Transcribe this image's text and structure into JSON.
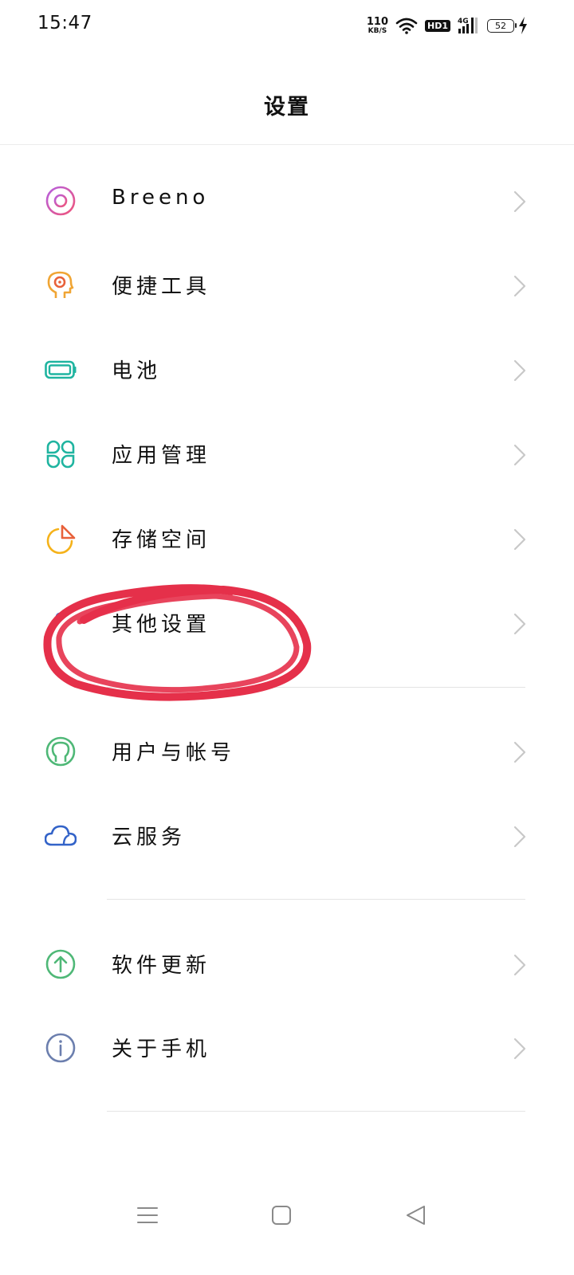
{
  "status_bar": {
    "time": "15:47",
    "net_speed_value": "110",
    "net_speed_unit": "KB/S",
    "hd_label": "HD1",
    "network_label": "4G",
    "battery_level": "52"
  },
  "header": {
    "title": "设置"
  },
  "settings": {
    "items": [
      {
        "label": "Breeno",
        "icon": "breeno-icon",
        "color": "#c85bc4"
      },
      {
        "label": "便捷工具",
        "icon": "convenience-tools-icon",
        "color": "#f0a534"
      },
      {
        "label": "电池",
        "icon": "battery-icon",
        "color": "#1fb4a0"
      },
      {
        "label": "应用管理",
        "icon": "app-management-icon",
        "color": "#1fb4a0"
      },
      {
        "label": "存储空间",
        "icon": "storage-icon",
        "color": "#f5b21a"
      },
      {
        "label": "其他设置",
        "icon": "other-settings-icon",
        "color": "#4a6fd0"
      },
      {
        "label": "用户与帐号",
        "icon": "user-account-icon",
        "color": "#4fb877"
      },
      {
        "label": "云服务",
        "icon": "cloud-service-icon",
        "color": "#3363c8"
      },
      {
        "label": "软件更新",
        "icon": "software-update-icon",
        "color": "#4fb877"
      },
      {
        "label": "关于手机",
        "icon": "about-phone-icon",
        "color": "#6c7fae"
      }
    ]
  },
  "annotation": {
    "color": "#e5304a"
  },
  "nav_bar": {
    "icons": [
      "menu-icon",
      "home-icon",
      "back-icon"
    ]
  }
}
